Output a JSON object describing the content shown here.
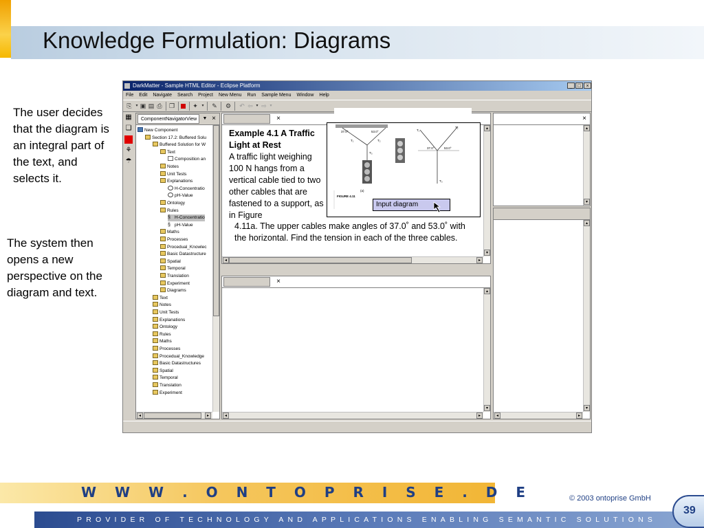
{
  "slide": {
    "title": "Knowledge Formulation: Diagrams",
    "left_text_1": "The user decides that the diagram is an integral part of the text, and selects it.",
    "left_text_2": "The system then opens a new perspective on the diagram and text.",
    "footer_url": "W W W . O N T O P R I S E . D E",
    "copyright": "©  2003  ontoprise GmbH",
    "tagline": "PROVIDER OF TECHNOLOGY AND APPLICATIONS ENABLING SEMANTIC SOLUTIONS",
    "page_number": "39",
    "colors": {
      "brand_blue": "#1f3f84",
      "orange": "#f2b636",
      "title_bar": "#0a246a"
    }
  },
  "app": {
    "window_title": "DarkMatter - Sample HTML Editor - Eclipse Platform",
    "window_buttons": {
      "minimize": "_",
      "maximize": "□",
      "close": "×"
    },
    "menu": [
      "File",
      "Edit",
      "Navigate",
      "Search",
      "Project",
      "New Menu",
      "Run",
      "Sample Menu",
      "Window",
      "Help"
    ],
    "navigator": {
      "tab_label": "ComponentNavigatorView",
      "tree": [
        {
          "label": "New Component",
          "depth": 0,
          "icon": "root"
        },
        {
          "label": "Section 17.2: Buffered Solu",
          "depth": 1,
          "icon": "folder"
        },
        {
          "label": "Buffered Solution for W",
          "depth": 2,
          "icon": "folder"
        },
        {
          "label": "Text",
          "depth": 3,
          "icon": "folder"
        },
        {
          "label": "Composition an",
          "depth": 4,
          "icon": "doc"
        },
        {
          "label": "Notes",
          "depth": 3,
          "icon": "folder"
        },
        {
          "label": "Unit Tests",
          "depth": 3,
          "icon": "folder"
        },
        {
          "label": "Explanations",
          "depth": 3,
          "icon": "folder"
        },
        {
          "label": "H-Concentratio",
          "depth": 4,
          "icon": "info"
        },
        {
          "label": "pH-Value",
          "depth": 4,
          "icon": "info"
        },
        {
          "label": "Ontology",
          "depth": 3,
          "icon": "folder"
        },
        {
          "label": "Rules",
          "depth": 3,
          "icon": "folder"
        },
        {
          "label": "H-Concentratio",
          "depth": 4,
          "icon": "rule",
          "selected": true
        },
        {
          "label": "pH-Value",
          "depth": 4,
          "icon": "rule"
        },
        {
          "label": "Maths",
          "depth": 3,
          "icon": "folder"
        },
        {
          "label": "Processes",
          "depth": 3,
          "icon": "folder"
        },
        {
          "label": "Procedual_Knowlec",
          "depth": 3,
          "icon": "folder"
        },
        {
          "label": "Basic Datastructure",
          "depth": 3,
          "icon": "folder"
        },
        {
          "label": "Spatial",
          "depth": 3,
          "icon": "folder"
        },
        {
          "label": "Temporal",
          "depth": 3,
          "icon": "folder"
        },
        {
          "label": "Translation",
          "depth": 3,
          "icon": "folder"
        },
        {
          "label": "Experiment",
          "depth": 3,
          "icon": "folder"
        },
        {
          "label": "Diagrams",
          "depth": 3,
          "icon": "folder"
        },
        {
          "label": "Text",
          "depth": 2,
          "icon": "folder"
        },
        {
          "label": "Notes",
          "depth": 2,
          "icon": "folder"
        },
        {
          "label": "Unit Tests",
          "depth": 2,
          "icon": "folder"
        },
        {
          "label": "Explanations",
          "depth": 2,
          "icon": "folder"
        },
        {
          "label": "Ontology",
          "depth": 2,
          "icon": "folder"
        },
        {
          "label": "Rules",
          "depth": 2,
          "icon": "folder"
        },
        {
          "label": "Maths",
          "depth": 2,
          "icon": "folder"
        },
        {
          "label": "Processes",
          "depth": 2,
          "icon": "folder"
        },
        {
          "label": "Procedual_Knowledge",
          "depth": 2,
          "icon": "folder"
        },
        {
          "label": "Basic Datastructures",
          "depth": 2,
          "icon": "folder"
        },
        {
          "label": "Spatial",
          "depth": 2,
          "icon": "folder"
        },
        {
          "label": "Temporal",
          "depth": 2,
          "icon": "folder"
        },
        {
          "label": "Translation",
          "depth": 2,
          "icon": "folder"
        },
        {
          "label": "Experiment",
          "depth": 2,
          "icon": "folder"
        }
      ]
    },
    "editor": {
      "example_title": "Example 4.1 A Traffic Light at Rest",
      "example_body_1": "A traffic light weighing 100 N hangs from a vertical cable tied to two other cables that are fastened to a support, as in Figure",
      "example_body_2": "4.11a. The upper cables make angles of 37.0˚ and 53.0˚ with the horizontal. Find the tension in each of the three cables.",
      "diagram_angle_left": "37.0°",
      "diagram_angle_right": "53.0°",
      "diagram_angle_left_b": "37.0°",
      "diagram_angle_right_b": "53.0°",
      "diagram_label_t1": "T₁",
      "diagram_label_t2": "T₂",
      "diagram_label_t3": "T₃",
      "diagram_fig_a": "(a)",
      "diagram_caption": "FIGURE 4.11",
      "input_diagram_label": "Input diagram"
    }
  }
}
